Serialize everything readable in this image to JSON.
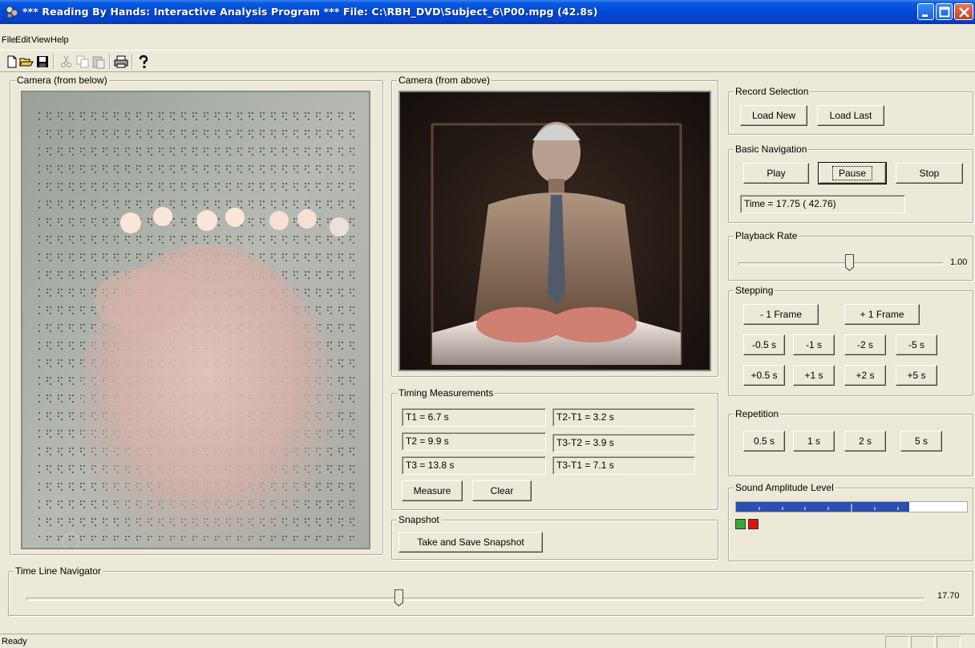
{
  "window": {
    "title": "*** Reading By Hands: Interactive Analysis Program ***   File: C:\\RBH_DVD\\Subject_6\\P00.mpg  (42.8s)"
  },
  "menu": [
    "File",
    "Edit",
    "View",
    "Help"
  ],
  "toolbar": {
    "icons": [
      "new-file-icon",
      "open-folder-icon",
      "save-icon",
      "cut-icon",
      "copy-icon",
      "paste-icon",
      "print-icon",
      "help-icon"
    ]
  },
  "camera_below": {
    "label": "Camera (from below)"
  },
  "camera_above": {
    "label": "Camera (from above)"
  },
  "timing": {
    "label": "Timing Measurements",
    "t1": "T1 =  6.7 s",
    "t2": "T2 =  9.9 s",
    "t3": "T3 = 13.8 s",
    "t2t1": "T2-T1 =  3.2 s",
    "t3t2": "T3-T2 =  3.9 s",
    "t3t1": "T3-T1 =  7.1 s",
    "measure": "Measure",
    "clear": "Clear"
  },
  "snapshot": {
    "label": "Snapshot",
    "button": "Take and Save Snapshot"
  },
  "record": {
    "label": "Record Selection",
    "load_new": "Load New",
    "load_last": "Load Last"
  },
  "navigation": {
    "label": "Basic Navigation",
    "play": "Play",
    "pause": "Pause",
    "stop": "Stop",
    "time": "Time = 17.75 ( 42.76)"
  },
  "playback": {
    "label": "Playback Rate",
    "value": "1.00",
    "position": 0.54
  },
  "stepping": {
    "label": "Stepping",
    "minus_frame": "- 1 Frame",
    "plus_frame": "+ 1 Frame",
    "minus": [
      "-0.5 s",
      "-1 s",
      "-2 s",
      "-5 s"
    ],
    "plus": [
      "+0.5 s",
      "+1 s",
      "+2 s",
      "+5 s"
    ]
  },
  "repetition": {
    "label": "Repetition",
    "buttons": [
      "0.5 s",
      "1 s",
      "2 s",
      "5 s"
    ]
  },
  "sound": {
    "label": "Sound Amplitude Level",
    "level": 0.75,
    "indicator_colors": [
      "#3aa830",
      "#e01010"
    ]
  },
  "timeline": {
    "label": "Time Line Navigator",
    "value": "17.70",
    "position": 0.414
  },
  "status": {
    "text": "Ready"
  },
  "colors": {
    "face": "#ece9d8",
    "titlebar": "#0048d8",
    "meter": "#2a4fb0"
  }
}
